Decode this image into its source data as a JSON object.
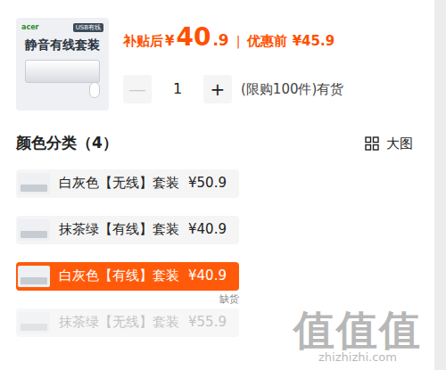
{
  "product": {
    "thumb_brand": "acer",
    "thumb_tag": "USB有线",
    "thumb_title": "静音有线套装",
    "price_label": "补贴后",
    "currency": "¥",
    "price_int": "40",
    "price_dec": ".9",
    "divider": "|",
    "orig_label": "优惠前 ¥45.9"
  },
  "quantity": {
    "minus": "—",
    "value": "1",
    "plus": "+",
    "minus_disabled": true,
    "note": "(限购100件)有货"
  },
  "section": {
    "title": "颜色分类（4）",
    "view_label": "大图"
  },
  "options": [
    {
      "label": "白灰色【无线】套装",
      "price": "¥50.9",
      "selected": false,
      "disabled": false
    },
    {
      "label": "抹茶绿【有线】套装",
      "price": "¥40.9",
      "selected": false,
      "disabled": false
    },
    {
      "label": "白灰色【有线】套装",
      "price": "¥40.9",
      "selected": true,
      "disabled": false
    },
    {
      "label": "抹茶绿【无线】套装",
      "price": "¥55.9",
      "selected": false,
      "disabled": true,
      "badge": "缺货"
    }
  ],
  "watermark": {
    "logo": "值值值",
    "url": "zhizhizhi.com"
  }
}
